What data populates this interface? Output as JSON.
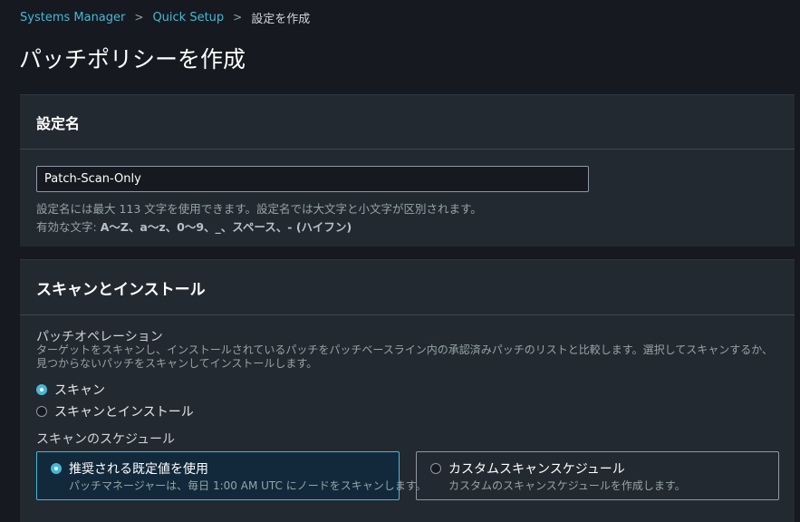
{
  "breadcrumb": {
    "items": [
      "Systems Manager",
      "Quick Setup"
    ],
    "current": "設定を作成"
  },
  "page": {
    "title": "パッチポリシーを作成"
  },
  "config_panel": {
    "title": "設定名",
    "name_value": "Patch-Scan-Only",
    "hint_line1": "設定名には最大 113 文字を使用できます。設定名では大文字と小文字が区別されます。",
    "hint_line2_prefix": "有効な文字: ",
    "hint_line2_chars": "A～Z、a～z、0～9、_、スペース、- (ハイフン)"
  },
  "scan_panel": {
    "title": "スキャンとインストール",
    "operation_label": "パッチオペレーション",
    "operation_desc": "ターゲットをスキャンし、インストールされているパッチをパッチベースライン内の承認済みパッチのリストと比較します。選択してスキャンするか、見つからないパッチをスキャンしてインストールします。",
    "options": [
      {
        "label": "スキャン",
        "selected": true
      },
      {
        "label": "スキャンとインストール",
        "selected": false
      }
    ],
    "schedule_label": "スキャンのスケジュール",
    "schedule_options": [
      {
        "title": "推奨される既定値を使用",
        "desc": "パッチマネージャーは、毎日 1:00 AM UTC にノードをスキャンします。",
        "selected": true
      },
      {
        "title": "カスタムスキャンスケジュール",
        "desc": "カスタムのスキャンスケジュールを作成します。",
        "selected": false
      }
    ]
  },
  "colors": {
    "accent": "#44b9d6",
    "background": "#16191f",
    "panel": "#232930"
  }
}
